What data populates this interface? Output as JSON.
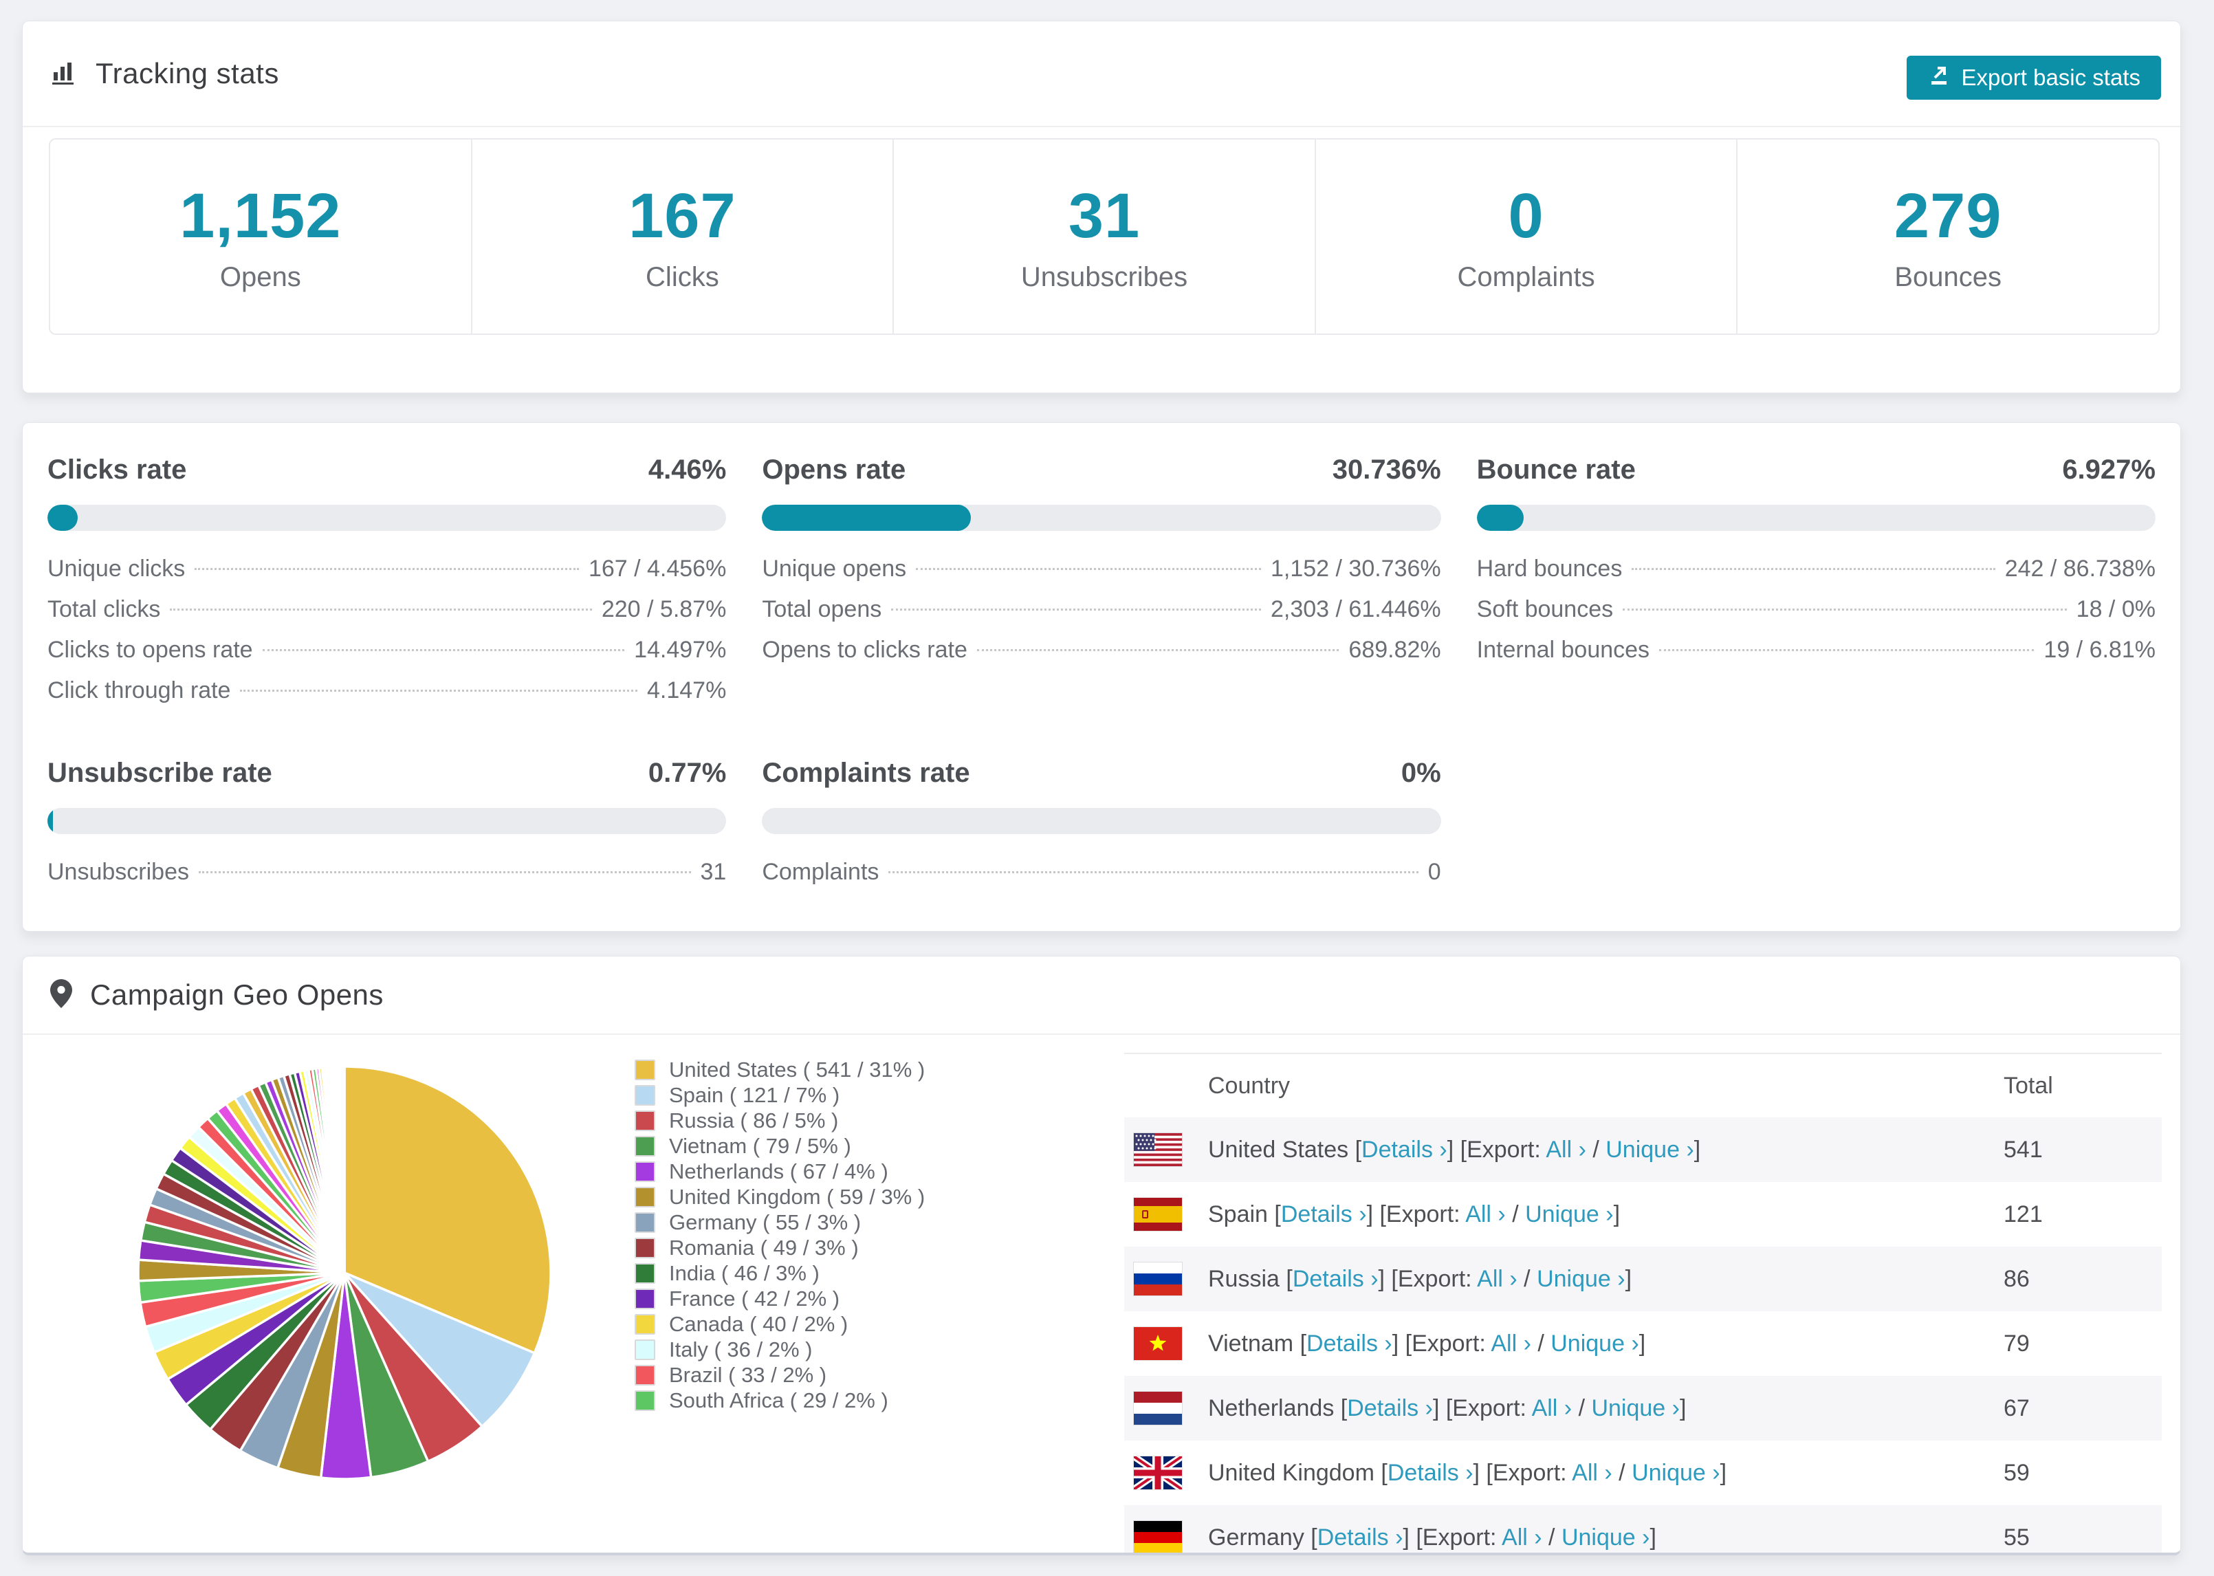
{
  "accent_color": "#0b90a8",
  "link_color": "#2f9abd",
  "page_background": "#f0f1f4",
  "tracking": {
    "title": "Tracking stats",
    "export_button_label": "Export basic stats",
    "stats": [
      {
        "value": "1,152",
        "label": "Opens"
      },
      {
        "value": "167",
        "label": "Clicks"
      },
      {
        "value": "31",
        "label": "Unsubscribes"
      },
      {
        "value": "0",
        "label": "Complaints"
      },
      {
        "value": "279",
        "label": "Bounces"
      }
    ]
  },
  "rates": [
    {
      "title": "Clicks rate",
      "value": "4.46%",
      "bar_pct": 4.46,
      "items": [
        {
          "label": "Unique clicks",
          "value": "167 / 4.456%"
        },
        {
          "label": "Total clicks",
          "value": "220 / 5.87%"
        },
        {
          "label": "Clicks to opens rate",
          "value": "14.497%"
        },
        {
          "label": "Click through rate",
          "value": "4.147%"
        }
      ]
    },
    {
      "title": "Opens rate",
      "value": "30.736%",
      "bar_pct": 30.736,
      "items": [
        {
          "label": "Unique opens",
          "value": "1,152 / 30.736%"
        },
        {
          "label": "Total opens",
          "value": "2,303 / 61.446%"
        },
        {
          "label": "Opens to clicks rate",
          "value": "689.82%"
        }
      ]
    },
    {
      "title": "Bounce rate",
      "value": "6.927%",
      "bar_pct": 6.927,
      "items": [
        {
          "label": "Hard bounces",
          "value": "242 / 86.738%"
        },
        {
          "label": "Soft bounces",
          "value": "18 / 0%"
        },
        {
          "label": "Internal bounces",
          "value": "19 / 6.81%"
        }
      ]
    },
    {
      "title": "Unsubscribe rate",
      "value": "0.77%",
      "bar_pct": 0.77,
      "items": [
        {
          "label": "Unsubscribes",
          "value": "31"
        }
      ]
    },
    {
      "title": "Complaints rate",
      "value": "0%",
      "bar_pct": 0,
      "items": [
        {
          "label": "Complaints",
          "value": "0"
        }
      ]
    }
  ],
  "geo": {
    "title": "Campaign Geo Opens",
    "chart_data": {
      "type": "pie",
      "title": "Campaign Geo Opens",
      "legend_position": "right",
      "start_angle_deg": 0,
      "direction": "clockwise",
      "slices": [
        {
          "label": "United States",
          "value": 541,
          "pct": "31%",
          "color": "#e9bf41"
        },
        {
          "label": "Spain",
          "value": 121,
          "pct": "7%",
          "color": "#b8d9f2"
        },
        {
          "label": "Russia",
          "value": 86,
          "pct": "5%",
          "color": "#c9494e"
        },
        {
          "label": "Vietnam",
          "value": 79,
          "pct": "5%",
          "color": "#4d9e51"
        },
        {
          "label": "Netherlands",
          "value": 67,
          "pct": "4%",
          "color": "#a33be0"
        },
        {
          "label": "United Kingdom",
          "value": 59,
          "pct": "3%",
          "color": "#b3912c"
        },
        {
          "label": "Germany",
          "value": 55,
          "pct": "3%",
          "color": "#8aa3bd"
        },
        {
          "label": "Romania",
          "value": 49,
          "pct": "3%",
          "color": "#9d3a3d"
        },
        {
          "label": "India",
          "value": 46,
          "pct": "3%",
          "color": "#2f7d39"
        },
        {
          "label": "France",
          "value": 42,
          "pct": "2%",
          "color": "#6f2ab8"
        },
        {
          "label": "Canada",
          "value": 40,
          "pct": "2%",
          "color": "#f2d73e"
        },
        {
          "label": "Italy",
          "value": 36,
          "pct": "2%",
          "color": "#d9fdff"
        },
        {
          "label": "Brazil",
          "value": 33,
          "pct": "2%",
          "color": "#f2575e"
        },
        {
          "label": "South Africa",
          "value": 29,
          "pct": "2%",
          "color": "#5dc763"
        }
      ],
      "others_unlabeled": {
        "note": "remaining small countries shown as thin unlabeled slices",
        "values": [
          28,
          26,
          25,
          24,
          23,
          22,
          21,
          20,
          19,
          18,
          17,
          16,
          15,
          14,
          13,
          12,
          11,
          10,
          9,
          9,
          8,
          8,
          7,
          7,
          6,
          6,
          5,
          5,
          4,
          4,
          3,
          3,
          3,
          2,
          2,
          2,
          2,
          1,
          1,
          1,
          1,
          1,
          1,
          1,
          1,
          1,
          1,
          1,
          1,
          1
        ],
        "colors": [
          "#b3912c",
          "#8b2fc0",
          "#4d9e51",
          "#c9494e",
          "#8aa3bd",
          "#9d3a3d",
          "#2f7d39",
          "#5d2a9e",
          "#f6f642",
          "#e8fdff",
          "#f2575e",
          "#5dc763",
          "#e24fe2",
          "#f2d73e",
          "#b8d9f2",
          "#e9bf41",
          "#c9494e",
          "#4d9e51",
          "#a33be0",
          "#b3912c",
          "#8aa3bd",
          "#9d3a3d",
          "#2f7d39",
          "#6f2ab8",
          "#f6f642",
          "#e8fdff",
          "#f2575e",
          "#5dc763",
          "#e24fe2",
          "#f2d73e",
          "#ffb3e8",
          "#b3ffcc",
          "#b3e8ff",
          "#ffd9b3",
          "#e8b3ff",
          "#ffffb3",
          "#ffe8e8",
          "#e8ffe8",
          "#e8e8ff",
          "#fff3f3",
          "#f3fff3",
          "#f3f3ff",
          "#fdf7ec",
          "#f7fdec",
          "#ecf7fd",
          "#fdecf7",
          "#f7ecfd",
          "#fcfcfc",
          "#fdfdfd",
          "#ffffff"
        ]
      },
      "legend_format": "{label} ( {value} / {pct} )"
    },
    "table": {
      "headers": {
        "country": "Country",
        "total": "Total"
      },
      "link_labels": {
        "details": "Details ›",
        "export_prefix": "Export:",
        "all": "All ›",
        "unique": "Unique ›"
      },
      "rows": [
        {
          "country": "United States",
          "flag": "us",
          "total": "541"
        },
        {
          "country": "Spain",
          "flag": "es",
          "total": "121"
        },
        {
          "country": "Russia",
          "flag": "ru",
          "total": "86"
        },
        {
          "country": "Vietnam",
          "flag": "vn",
          "total": "79"
        },
        {
          "country": "Netherlands",
          "flag": "nl",
          "total": "67"
        },
        {
          "country": "United Kingdom",
          "flag": "gb",
          "total": "59"
        },
        {
          "country": "Germany",
          "flag": "de",
          "total": "55"
        }
      ]
    }
  }
}
